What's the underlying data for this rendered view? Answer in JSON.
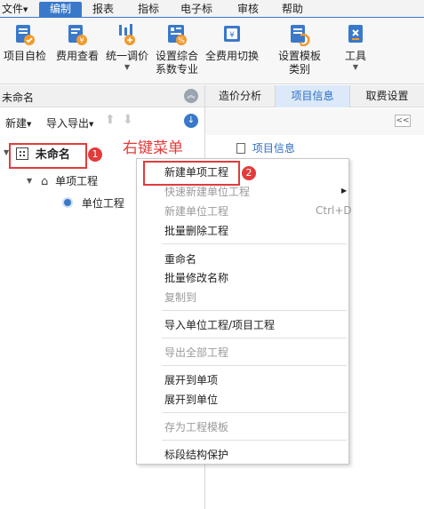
{
  "menubar": {
    "items": [
      {
        "label": "文件"
      },
      {
        "label": "编制"
      },
      {
        "label": "报表"
      },
      {
        "label": "指标"
      },
      {
        "label": "电子标"
      },
      {
        "label": "审核"
      },
      {
        "label": "帮助"
      }
    ]
  },
  "toolbar": {
    "buttons": [
      {
        "label": "项目自检",
        "icon": "project-check-icon"
      },
      {
        "label": "费用查看",
        "icon": "cost-view-icon"
      },
      {
        "label": "统一调价",
        "icon": "price-adjust-icon"
      },
      {
        "label": "设置综合",
        "label2": "系数专业",
        "icon": "settings-coefficient-icon"
      },
      {
        "label": "全费用切换",
        "icon": "full-cost-switch-icon"
      },
      {
        "label": "设置模板",
        "label2": "类别",
        "icon": "template-category-icon"
      },
      {
        "label": "工具",
        "icon": "tools-icon"
      }
    ],
    "colors": {
      "icon_blue": "#3a79c9",
      "icon_orange": "#f29a2e"
    }
  },
  "left_panel": {
    "title": "未命名",
    "tools": {
      "new_label": "新建",
      "import_export_label": "导入导出"
    },
    "tree": {
      "root": "未命名",
      "single_item": "单项工程",
      "unit_item": "单位工程"
    }
  },
  "right_panel": {
    "tabs": [
      {
        "label": "造价分析"
      },
      {
        "label": "项目信息"
      },
      {
        "label": "取费设置"
      }
    ],
    "collapse_label": "<<",
    "tree_root": "项目信息"
  },
  "annotation": {
    "context_menu_caption": "右键菜单",
    "badge1": "1",
    "badge2": "2",
    "color": "#e23b3b"
  },
  "context_menu": {
    "items": [
      {
        "label": "新建单项工程",
        "enabled": true
      },
      {
        "label": "快速新建单位工程",
        "enabled": false,
        "submenu": true
      },
      {
        "label": "新建单位工程",
        "enabled": false,
        "shortcut": "Ctrl+D"
      },
      {
        "label": "批量删除工程",
        "enabled": true
      },
      {
        "label": "重命名",
        "enabled": true
      },
      {
        "label": "批量修改名称",
        "enabled": true
      },
      {
        "label": "复制到",
        "enabled": false
      },
      {
        "label": "导入单位工程/项目工程",
        "enabled": true
      },
      {
        "label": "导出全部工程",
        "enabled": false
      },
      {
        "label": "展开到单项",
        "enabled": true
      },
      {
        "label": "展开到单位",
        "enabled": true
      },
      {
        "label": "存为工程模板",
        "enabled": false
      },
      {
        "label": "标段结构保护",
        "enabled": true
      }
    ]
  }
}
